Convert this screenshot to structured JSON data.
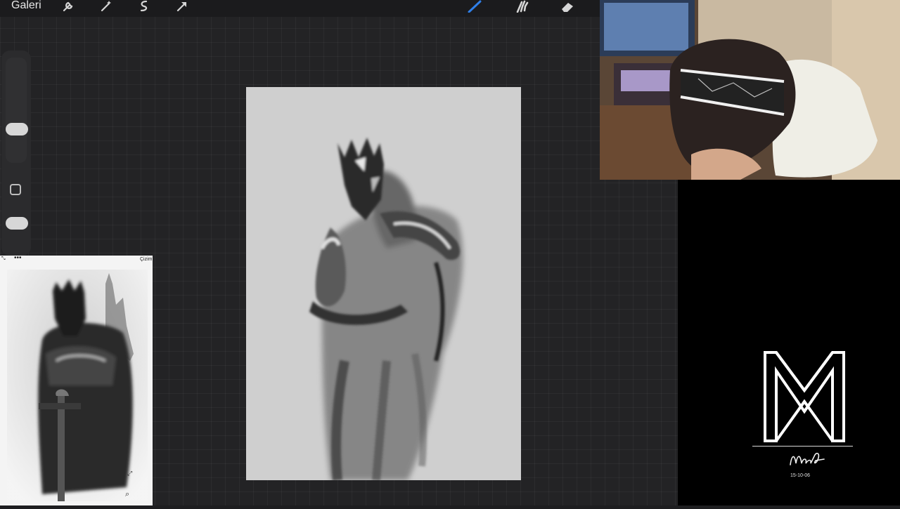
{
  "app": {
    "gallery_label": "Galeri"
  },
  "toolbar": {
    "left_tools": [
      "wrench-icon",
      "magic-wand-icon",
      "selection-icon",
      "transform-arrow-icon"
    ],
    "right_tools": [
      "brush-icon",
      "smudge-icon",
      "eraser-icon"
    ],
    "active_tool": "brush-icon",
    "active_color": "#2f7fe8"
  },
  "sidebar": {
    "brush_size": 0.5,
    "opacity": 0.5
  },
  "reference": {
    "title": "Çizim"
  },
  "branding": {
    "logo_text": "MM",
    "signature": "Murat",
    "date": "15-10-06"
  }
}
